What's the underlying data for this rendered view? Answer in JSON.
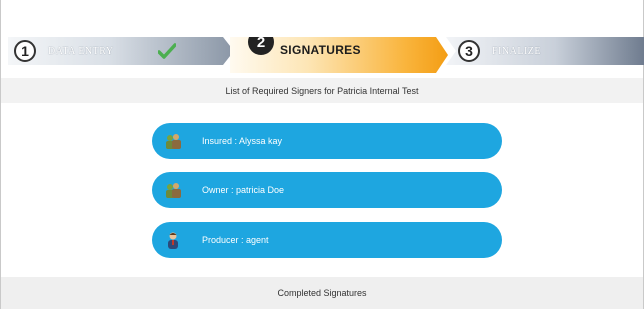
{
  "wizard": {
    "steps": [
      {
        "number": "1",
        "label": "DATA ENTRY",
        "state": "complete"
      },
      {
        "number": "2",
        "label": "SIGNATURES",
        "state": "active"
      },
      {
        "number": "3",
        "label": "FINALIZE",
        "state": "pending"
      }
    ]
  },
  "signers_section": {
    "title": "List of Required Signers for Patricia Internal Test",
    "signers": [
      {
        "label": "Insured : Alyssa kay",
        "icon": "people-icon"
      },
      {
        "label": "Owner : patricia Doe",
        "icon": "people-icon"
      },
      {
        "label": "Producer : agent",
        "icon": "person-icon"
      }
    ]
  },
  "completed_section": {
    "title": "Completed Signatures"
  },
  "colors": {
    "signer_button": "#1ea6e0",
    "active_step": "#f39c12",
    "check": "#4caf50"
  }
}
